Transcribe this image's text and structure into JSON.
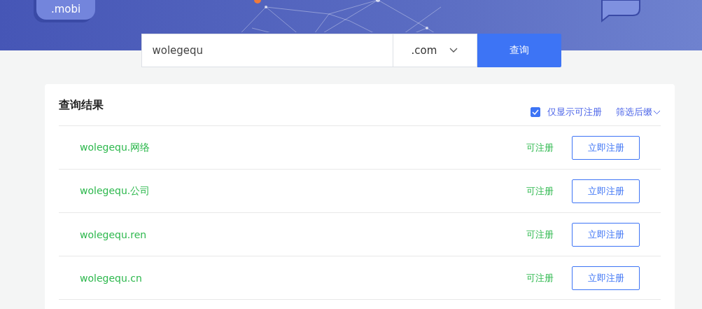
{
  "banner": {
    "bubble_label": ".mobi"
  },
  "search": {
    "value": "wolegequ",
    "suffix": ".com",
    "button": "查询"
  },
  "results": {
    "title": "查询结果",
    "filter_checkbox": {
      "label": "仅显示可注册",
      "checked": true
    },
    "filter_suffix": "筛选后缀",
    "rows": [
      {
        "domain": "wolegequ.网络",
        "status": "可注册",
        "action": "立即注册"
      },
      {
        "domain": "wolegequ.公司",
        "status": "可注册",
        "action": "立即注册"
      },
      {
        "domain": "wolegequ.ren",
        "status": "可注册",
        "action": "立即注册"
      },
      {
        "domain": "wolegequ.cn",
        "status": "可注册",
        "action": "立即注册"
      }
    ]
  }
}
